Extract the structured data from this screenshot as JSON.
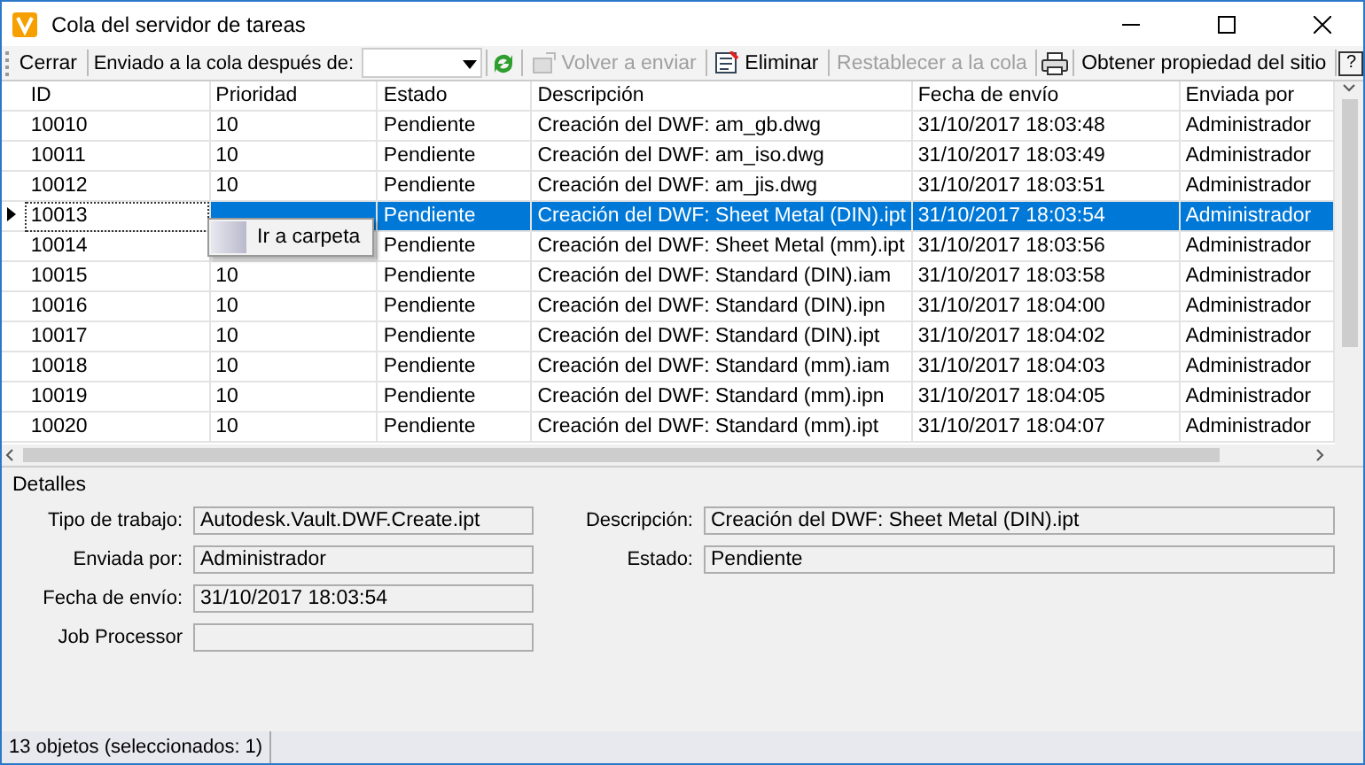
{
  "window": {
    "title": "Cola del servidor de tareas"
  },
  "toolbar": {
    "close": {
      "label": "Cerrar"
    },
    "filter_label": "Enviado a la cola después de:",
    "resend": {
      "label": "Volver a enviar",
      "disabled": true
    },
    "delete": {
      "label": "Eliminar",
      "disabled": false
    },
    "reset": {
      "label": "Restablecer a la cola",
      "disabled": true
    },
    "site_property": {
      "label": "Obtener propiedad del sitio"
    },
    "help": {
      "label": "?"
    }
  },
  "table": {
    "columns": [
      "ID",
      "Prioridad",
      "Estado",
      "Descripción",
      "Fecha de envío",
      "Enviada por"
    ],
    "rows": [
      {
        "cells": [
          "10010",
          "10",
          "Pendiente",
          "Creación del DWF: am_gb.dwg",
          "31/10/2017 18:03:48",
          "Administrador"
        ],
        "selected": false
      },
      {
        "cells": [
          "10011",
          "10",
          "Pendiente",
          "Creación del DWF: am_iso.dwg",
          "31/10/2017 18:03:49",
          "Administrador"
        ],
        "selected": false
      },
      {
        "cells": [
          "10012",
          "10",
          "Pendiente",
          "Creación del DWF: am_jis.dwg",
          "31/10/2017 18:03:51",
          "Administrador"
        ],
        "selected": false
      },
      {
        "cells": [
          "10013",
          null,
          "Pendiente",
          "Creación del DWF: Sheet Metal (DIN).ipt",
          "31/10/2017 18:03:54",
          "Administrador"
        ],
        "selected": true
      },
      {
        "cells": [
          "10014",
          null,
          "Pendiente",
          "Creación del DWF: Sheet Metal (mm).ipt",
          "31/10/2017 18:03:56",
          "Administrador"
        ],
        "selected": false
      },
      {
        "cells": [
          "10015",
          "10",
          "Pendiente",
          "Creación del DWF: Standard (DIN).iam",
          "31/10/2017 18:03:58",
          "Administrador"
        ],
        "selected": false
      },
      {
        "cells": [
          "10016",
          "10",
          "Pendiente",
          "Creación del DWF: Standard (DIN).ipn",
          "31/10/2017 18:04:00",
          "Administrador"
        ],
        "selected": false
      },
      {
        "cells": [
          "10017",
          "10",
          "Pendiente",
          "Creación del DWF: Standard (DIN).ipt",
          "31/10/2017 18:04:02",
          "Administrador"
        ],
        "selected": false
      },
      {
        "cells": [
          "10018",
          "10",
          "Pendiente",
          "Creación del DWF: Standard (mm).iam",
          "31/10/2017 18:04:03",
          "Administrador"
        ],
        "selected": false
      },
      {
        "cells": [
          "10019",
          "10",
          "Pendiente",
          "Creación del DWF: Standard (mm).ipn",
          "31/10/2017 18:04:05",
          "Administrador"
        ],
        "selected": false
      },
      {
        "cells": [
          "10020",
          "10",
          "Pendiente",
          "Creación del DWF: Standard (mm).ipt",
          "31/10/2017 18:04:07",
          "Administrador"
        ],
        "selected": false
      }
    ]
  },
  "context_menu": {
    "items": [
      "Ir a carpeta"
    ]
  },
  "details": {
    "title": "Detalles",
    "left": [
      {
        "label": "Tipo de trabajo:",
        "value": "Autodesk.Vault.DWF.Create.ipt"
      },
      {
        "label": "Enviada por:",
        "value": "Administrador"
      },
      {
        "label": "Fecha de envío:",
        "value": "31/10/2017 18:03:54"
      },
      {
        "label": "Job Processor"
      }
    ],
    "right": [
      {
        "label": "Descripción:",
        "value": "Creación del DWF: Sheet Metal (DIN).ipt"
      },
      {
        "label": "Estado:",
        "value": "Pendiente"
      }
    ]
  },
  "status_bar": {
    "text": "13 objetos (seleccionados: 1)"
  }
}
